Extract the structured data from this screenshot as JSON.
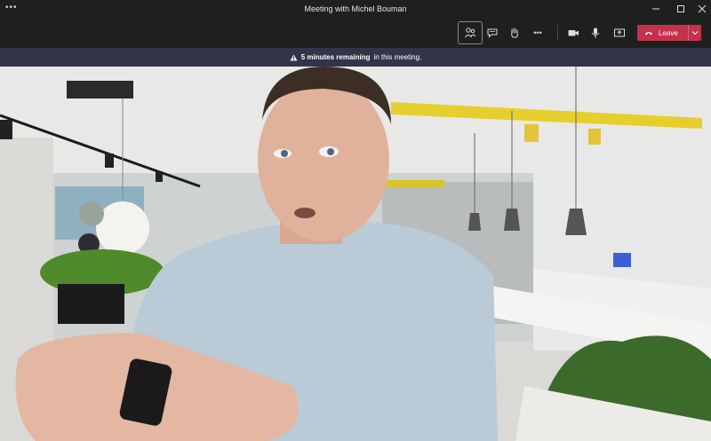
{
  "window": {
    "title": "Meeting with Michel Bouman",
    "menu_glyph": "•••"
  },
  "toolbar": {
    "buttons": [
      "people-icon",
      "chat-icon",
      "raise-hand-icon",
      "more-icon",
      "camera-icon",
      "microphone-icon",
      "share-screen-icon"
    ],
    "more_glyph": "•••",
    "leave_label": "Leave"
  },
  "banner": {
    "bold_text": "5 minutes remaining",
    "rest_text": "in this meeting."
  },
  "colors": {
    "leave": "#c4314b",
    "banner": "#33344a",
    "titlebar": "#1f1f1f"
  }
}
